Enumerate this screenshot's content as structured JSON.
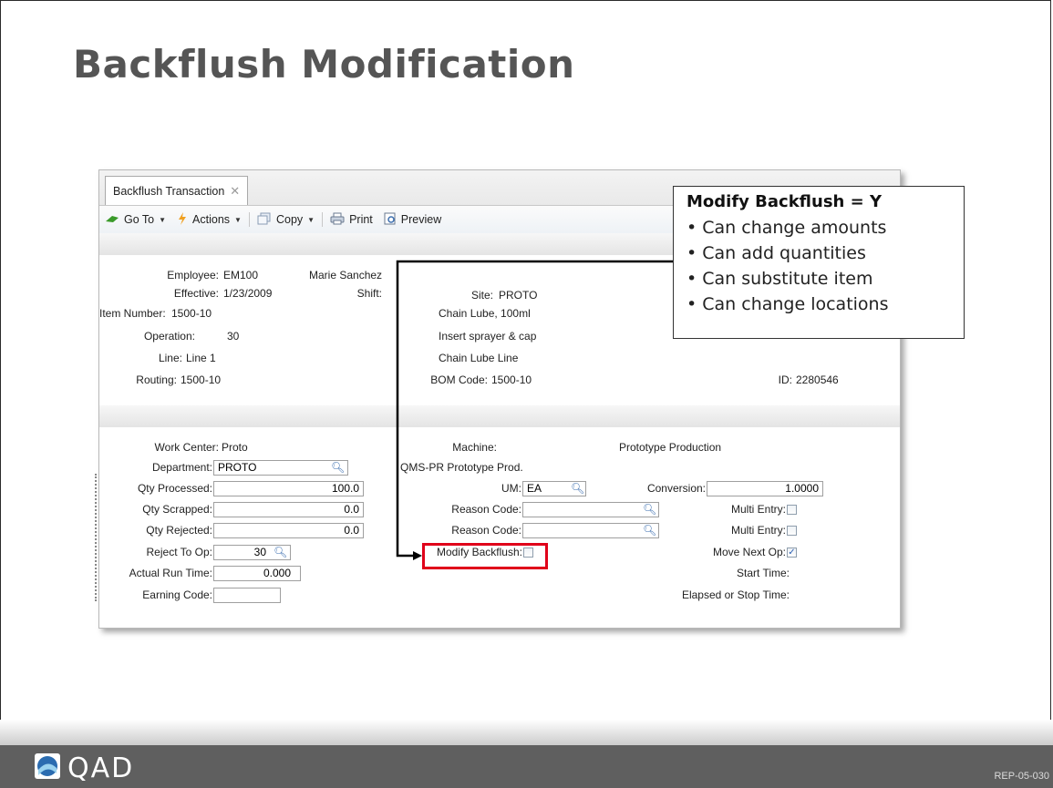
{
  "slide": {
    "title": "Backflush Modification",
    "code": "REP-05-030"
  },
  "window": {
    "tab_label": "Backflush Transaction",
    "tab_close": "✕",
    "toolbar": {
      "goto": "Go To",
      "actions": "Actions",
      "copy": "Copy",
      "print": "Print",
      "preview": "Preview"
    }
  },
  "header": {
    "employee_label": "Employee:",
    "employee_value": "EM100",
    "employee_name": "Marie Sanchez",
    "effective_label": "Effective:",
    "effective_value": "1/23/2009",
    "shift_label": "Shift:",
    "site_label": "Site:",
    "site_value": "PROTO",
    "item_label": "Item Number:",
    "item_value": "1500-10",
    "item_desc1": "Chain Lube, 100ml",
    "operation_label": "Operation:",
    "operation_value": "30",
    "item_desc2": "Insert sprayer & cap",
    "line_label": "Line:",
    "line_value": "Line 1",
    "line_desc": "Chain Lube Line",
    "routing_label": "Routing:",
    "routing_value": "1500-10",
    "bom_label": "BOM Code:",
    "bom_value": "1500-10",
    "id_label": "ID:",
    "id_value": "2280546"
  },
  "form": {
    "work_center_label": "Work Center:",
    "work_center_value": "Proto",
    "machine_label": "Machine:",
    "machine_value": "Prototype Production",
    "department_label": "Department:",
    "department_value": "PROTO",
    "department_desc": "QMS-PR Prototype Prod.",
    "qty_processed_label": "Qty Processed:",
    "qty_processed_value": "100.0",
    "um_label": "UM:",
    "um_value": "EA",
    "conversion_label": "Conversion:",
    "conversion_value": "1.0000",
    "qty_scrapped_label": "Qty Scrapped:",
    "qty_scrapped_value": "0.0",
    "reason_code_label": "Reason Code:",
    "reason_code_1_value": "",
    "multi_entry_label": "Multi Entry:",
    "qty_rejected_label": "Qty Rejected:",
    "qty_rejected_value": "0.0",
    "reason_code_2_value": "",
    "reject_to_op_label": "Reject To Op:",
    "reject_to_op_value": "30",
    "modify_backflush_label": "Modify Backflush:",
    "modify_backflush_checked": false,
    "move_next_op_label": "Move Next Op:",
    "move_next_op_checked": true,
    "actual_run_time_label": "Actual Run Time:",
    "actual_run_time_value": "0.000",
    "start_time_label": "Start Time:",
    "earning_code_label": "Earning Code:",
    "earning_code_value": "",
    "elapsed_label": "Elapsed or Stop Time:"
  },
  "callout": {
    "heading": "Modify Backflush = Y",
    "items": [
      "Can change amounts",
      "Can add quantities",
      "Can substitute item",
      "Can change locations"
    ]
  },
  "footer": {
    "logo_text": "QAD"
  },
  "colors": {
    "title": "#555555",
    "highlight": "#e0001a",
    "footer": "#5f5f5f"
  }
}
